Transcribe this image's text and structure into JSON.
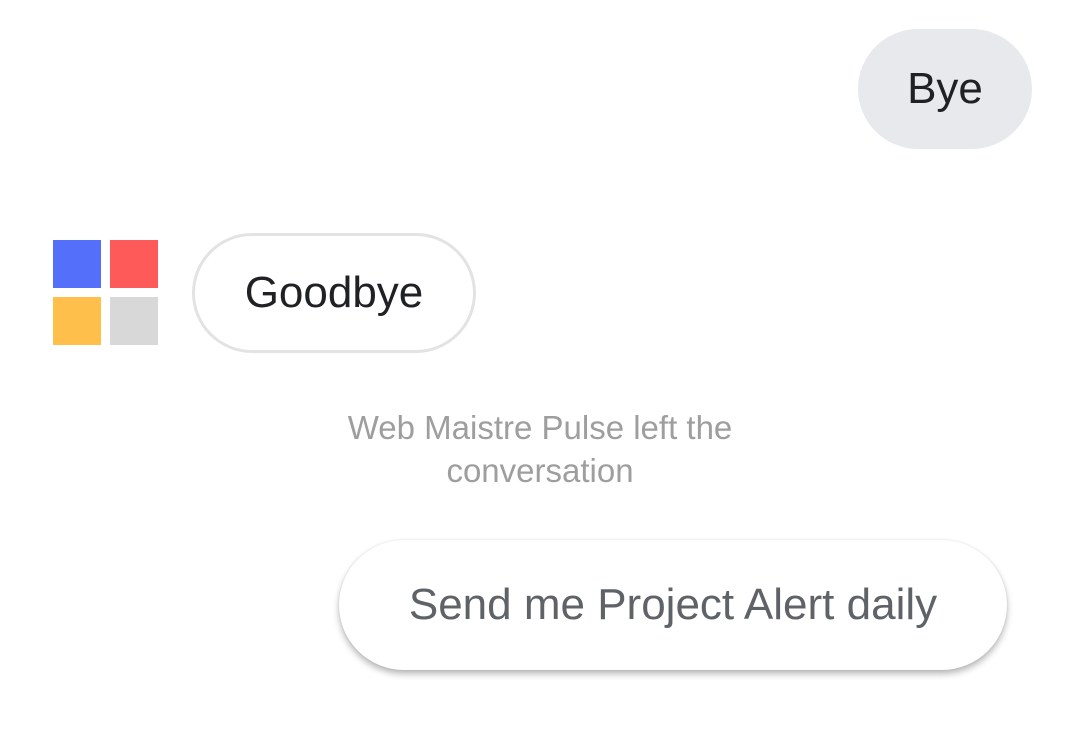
{
  "messages": {
    "user_message": "Bye",
    "bot_message": "Goodbye",
    "system_note": "Web Maistre Pulse left the conversation"
  },
  "suggestions": {
    "chip_label": "Send me Project Alert daily"
  },
  "avatar": {
    "icon": "four-squares-logo-icon",
    "colors": {
      "top_left": "#5470fb",
      "top_right": "#ff5a5a",
      "bottom_left": "#ffbf4a",
      "bottom_right": "#d8d8d8"
    }
  },
  "colors": {
    "user_bubble_bg": "#e8e9ed",
    "bot_bubble_border": "#e3e3e3",
    "system_text": "#9e9e9e",
    "chip_text": "#5f6368"
  }
}
